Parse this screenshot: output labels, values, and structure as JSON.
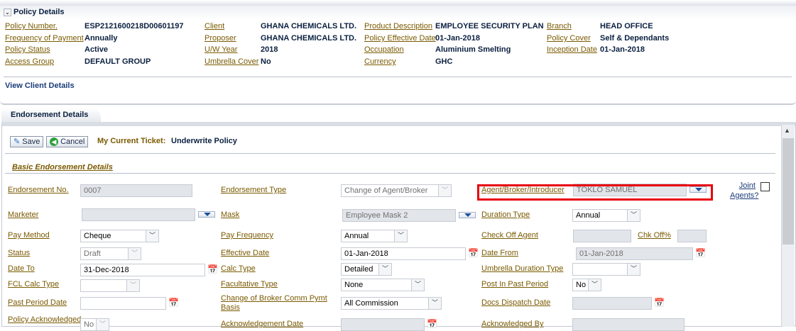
{
  "policy": {
    "title": "Policy Details",
    "fields": [
      {
        "label": "Policy Number.",
        "value": "ESP2121600218D00601197"
      },
      {
        "label": "Frequency of Payment",
        "value": "Annually"
      },
      {
        "label": "Policy Status",
        "value": "Active"
      },
      {
        "label": "Access Group",
        "value": "DEFAULT GROUP"
      },
      {
        "label": "Client",
        "value": "GHANA CHEMICALS LTD."
      },
      {
        "label": "Proposer",
        "value": "GHANA CHEMICALS LTD."
      },
      {
        "label": "U/W Year",
        "value": "2018"
      },
      {
        "label": "Umbrella Cover",
        "value": "No"
      },
      {
        "label": "Product Description",
        "value": "EMPLOYEE SECURITY PLAN"
      },
      {
        "label": "Policy Effective Date",
        "value": "01-Jan-2018"
      },
      {
        "label": "Occupation",
        "value": "Aluminium Smelting"
      },
      {
        "label": "Currency",
        "value": "GHC"
      },
      {
        "label": "Branch",
        "value": "HEAD OFFICE"
      },
      {
        "label": "Policy Cover",
        "value": "Self & Dependants"
      },
      {
        "label": "Inception Date",
        "value": "01-Jan-2018"
      }
    ],
    "view_client": "View Client Details"
  },
  "endorsement": {
    "tab": "Endorsement Details",
    "save": "Save",
    "cancel": "Cancel",
    "ticket_label": "My Current Ticket:",
    "ticket_value": "Underwrite Policy",
    "section": "Basic Endorsement Details",
    "f": {
      "endorsement_no": {
        "label": "Endorsement No.",
        "value": "0007"
      },
      "endorsement_type": {
        "label": "Endorsement Type",
        "value": "Change of Agent/Broker"
      },
      "agent": {
        "label": "Agent/Broker/Introducer",
        "value": "TOKLO SAMUEL"
      },
      "joint_agents": {
        "label": "Joint Agents?"
      },
      "marketer": {
        "label": "Marketer",
        "value": ""
      },
      "mask": {
        "label": "Mask",
        "value": "Employee Mask 2"
      },
      "duration_type": {
        "label": "Duration Type",
        "value": "Annual"
      },
      "pay_method": {
        "label": "Pay Method",
        "value": "Cheque"
      },
      "pay_frequency": {
        "label": "Pay Frequency",
        "value": "Annual"
      },
      "check_off_agent": {
        "label": "Check Off Agent",
        "value": ""
      },
      "chk_off": {
        "label": "Chk Off%",
        "value": ""
      },
      "status": {
        "label": "Status",
        "value": "Draft"
      },
      "effective_date": {
        "label": "Effective Date",
        "value": "01-Jan-2018"
      },
      "date_from": {
        "label": "Date From",
        "value": "01-Jan-2018"
      },
      "date_to": {
        "label": "Date To",
        "value": "31-Dec-2018"
      },
      "calc_type": {
        "label": "Calc Type",
        "value": "Detailed"
      },
      "umbrella_duration": {
        "label": "Umbrella Duration Type",
        "value": ""
      },
      "fcl_calc": {
        "label": "FCL Calc Type",
        "value": ""
      },
      "facultative": {
        "label": "Facultative Type",
        "value": "None"
      },
      "post_past": {
        "label": "Post In Past Period",
        "value": "No"
      },
      "past_period_date": {
        "label": "Past Period Date",
        "value": ""
      },
      "broker_comm": {
        "label": "Change of Broker Comm Pymt Basis",
        "value": "All Commission"
      },
      "docs_dispatch": {
        "label": "Docs Dispatch Date",
        "value": ""
      },
      "policy_ack": {
        "label": "Policy Acknowledged",
        "value": "No"
      },
      "ack_date": {
        "label": "Acknowledgement Date",
        "value": ""
      },
      "ack_by": {
        "label": "Acknowledged By",
        "value": ""
      }
    }
  },
  "colors": {
    "highlight": "#e8000b",
    "label": "#7a5a00",
    "value": "#0a2040"
  }
}
